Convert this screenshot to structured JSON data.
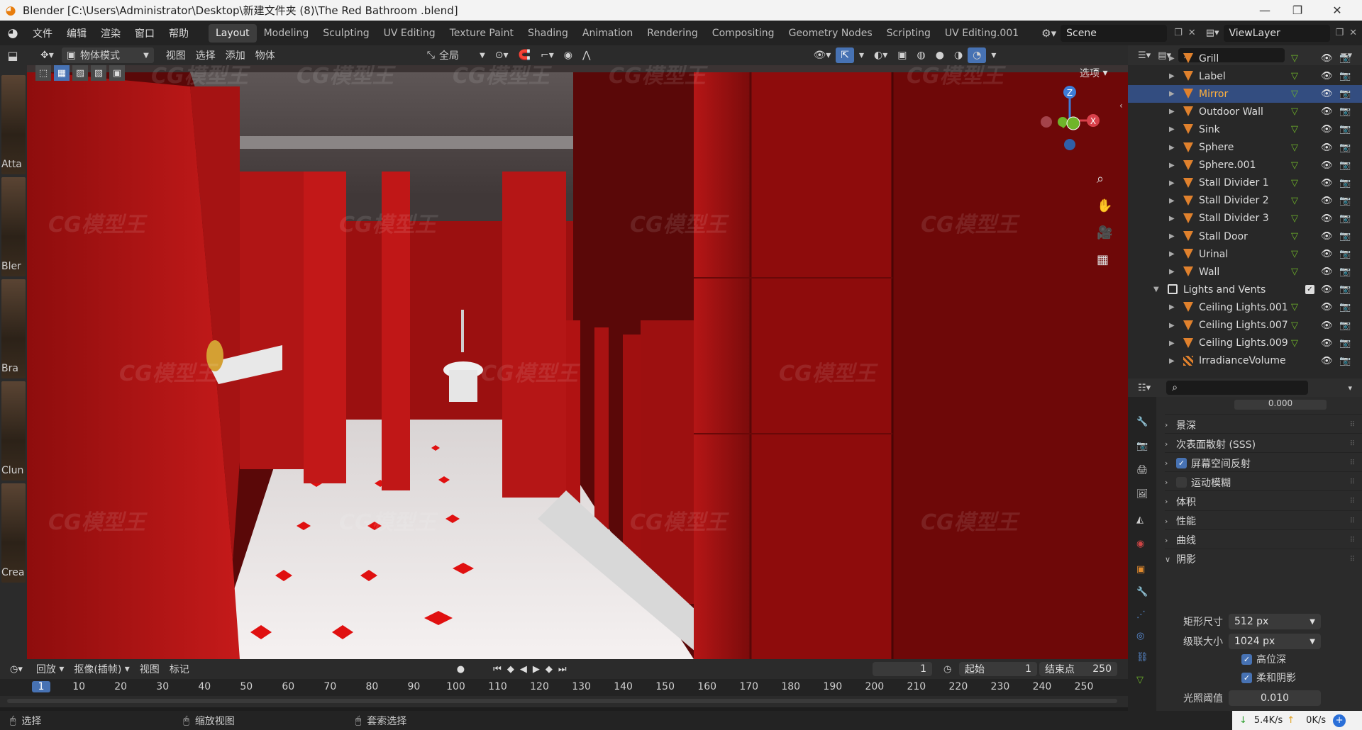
{
  "window": {
    "title": "Blender [C:\\Users\\Administrator\\Desktop\\新建文件夹 (8)\\The Red Bathroom .blend]",
    "minimize": "—",
    "maximize": "❐",
    "close": "✕"
  },
  "menu": [
    "文件",
    "编辑",
    "渲染",
    "窗口",
    "帮助"
  ],
  "workspaces": [
    "Layout",
    "Modeling",
    "Sculpting",
    "UV Editing",
    "Texture Paint",
    "Shading",
    "Animation",
    "Rendering",
    "Compositing",
    "Geometry Nodes",
    "Scripting",
    "UV Editing.001"
  ],
  "active_workspace": "Layout",
  "scene": {
    "label": "Scene",
    "view_layer": "ViewLayer"
  },
  "viewport_header": {
    "mode": "物体模式",
    "menus": [
      "视图",
      "选择",
      "添加",
      "物体"
    ],
    "transform": "全局",
    "options": "选项"
  },
  "left_assets": [
    "Atta",
    "Bler",
    "Bra",
    "Clun",
    "Crea"
  ],
  "outliner": {
    "rows": [
      {
        "name": "Grill",
        "type": "mesh",
        "selected": false,
        "indent": 1
      },
      {
        "name": "Label",
        "type": "mesh",
        "selected": false,
        "indent": 1
      },
      {
        "name": "Mirror",
        "type": "mesh",
        "selected": true,
        "indent": 1
      },
      {
        "name": "Outdoor Wall",
        "type": "mesh",
        "selected": false,
        "indent": 1
      },
      {
        "name": "Sink",
        "type": "mesh",
        "selected": false,
        "indent": 1
      },
      {
        "name": "Sphere",
        "type": "mesh",
        "selected": false,
        "indent": 1
      },
      {
        "name": "Sphere.001",
        "type": "mesh",
        "selected": false,
        "indent": 1
      },
      {
        "name": "Stall Divider 1",
        "type": "mesh",
        "selected": false,
        "indent": 1
      },
      {
        "name": "Stall Divider 2",
        "type": "mesh",
        "selected": false,
        "indent": 1
      },
      {
        "name": "Stall Divider 3",
        "type": "mesh",
        "selected": false,
        "indent": 1
      },
      {
        "name": "Stall Door",
        "type": "mesh",
        "selected": false,
        "indent": 1
      },
      {
        "name": "Urinal",
        "type": "mesh",
        "selected": false,
        "indent": 1
      },
      {
        "name": "Wall",
        "type": "mesh",
        "selected": false,
        "indent": 1
      },
      {
        "name": "Lights and Vents",
        "type": "collection",
        "selected": false,
        "indent": 0
      },
      {
        "name": "Ceiling Lights.001",
        "type": "mesh",
        "selected": false,
        "indent": 1
      },
      {
        "name": "Ceiling Lights.007",
        "type": "mesh",
        "selected": false,
        "indent": 1
      },
      {
        "name": "Ceiling Lights.009",
        "type": "mesh",
        "selected": false,
        "indent": 1
      },
      {
        "name": "IrradianceVolume",
        "type": "probe",
        "selected": false,
        "indent": 1
      }
    ]
  },
  "properties": {
    "top_partial": "0.000",
    "sections": [
      {
        "label": "景深",
        "checkbox": null,
        "open": false
      },
      {
        "label": "次表面散射 (SSS)",
        "checkbox": null,
        "open": false
      },
      {
        "label": "屏幕空间反射",
        "checkbox": true,
        "open": false
      },
      {
        "label": "运动模糊",
        "checkbox": false,
        "open": false
      },
      {
        "label": "体积",
        "checkbox": null,
        "open": false
      },
      {
        "label": "性能",
        "checkbox": null,
        "open": false
      },
      {
        "label": "曲线",
        "checkbox": null,
        "open": false
      },
      {
        "label": "阴影",
        "checkbox": null,
        "open": true
      }
    ],
    "shadow": {
      "cube_size_label": "矩形尺寸",
      "cube_size": "512 px",
      "cascade_size_label": "级联大小",
      "cascade_size": "1024 px",
      "high_bit_label": "高位深",
      "high_bit": true,
      "soft_label": "柔和阴影",
      "soft": true,
      "threshold_label": "光照阈值",
      "threshold": "0.010"
    }
  },
  "timeline": {
    "menus": [
      "回放",
      "抠像(插帧)",
      "视图",
      "标记"
    ],
    "current_frame": "1",
    "start_label": "起始",
    "start": "1",
    "end_label": "结束点",
    "end": "250",
    "ticks": [
      "1",
      "10",
      "20",
      "30",
      "40",
      "50",
      "60",
      "70",
      "80",
      "90",
      "100",
      "110",
      "120",
      "130",
      "140",
      "150",
      "160",
      "170",
      "180",
      "190",
      "200",
      "210",
      "220",
      "230",
      "240",
      "250"
    ]
  },
  "statusbar": {
    "select": "选择",
    "zoom": "缩放视图",
    "lasso": "套索选择",
    "down": "5.4K/s",
    "up": "0K/s"
  },
  "watermark": "CG模型王",
  "colors": {
    "accent": "#4772b3",
    "selected_row": "#334d80",
    "selected_text": "#ffb13d",
    "mesh_icon": "#e0812d",
    "check": "#4772b3"
  }
}
